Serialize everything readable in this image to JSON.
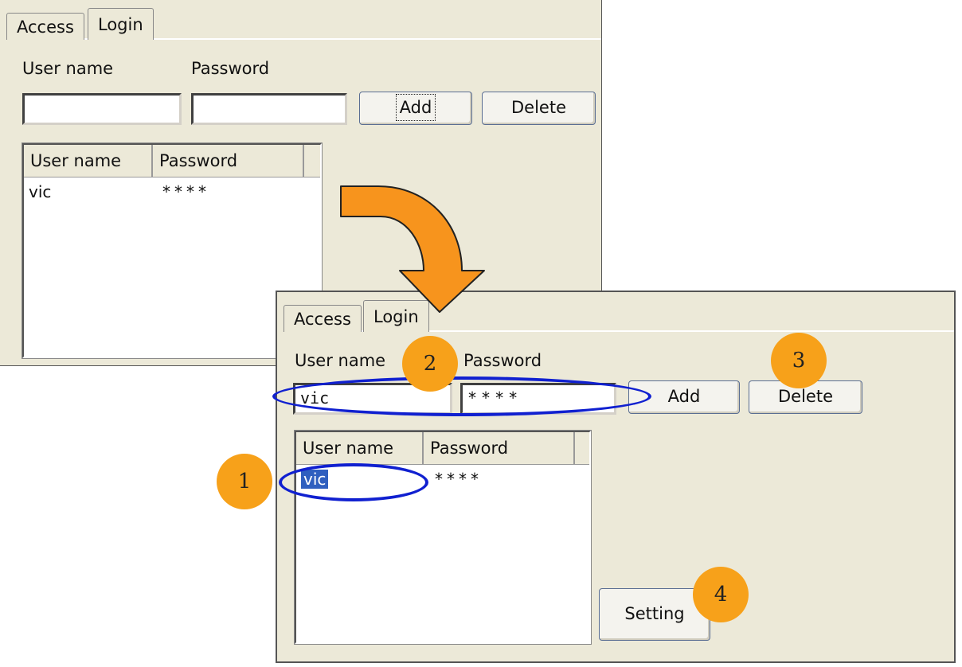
{
  "top_dialog": {
    "tabs": [
      {
        "label": "Access"
      },
      {
        "label": "Login"
      }
    ],
    "user_name_label": "User name",
    "password_label": "Password",
    "user_name_value": "",
    "password_value": "",
    "add_label": "Add",
    "delete_label": "Delete",
    "list": {
      "columns": [
        "User name",
        "Password"
      ],
      "rows": [
        {
          "user": "vic",
          "password": "****"
        }
      ]
    }
  },
  "bottom_dialog": {
    "tabs": [
      {
        "label": "Access"
      },
      {
        "label": "Login"
      }
    ],
    "user_name_label": "User name",
    "password_label": "Password",
    "user_name_value": "vic",
    "password_value": "****",
    "add_label": "Add",
    "delete_label": "Delete",
    "setting_label": "Setting",
    "list": {
      "columns": [
        "User name",
        "Password"
      ],
      "rows": [
        {
          "user": "vic",
          "password": "****",
          "selected": true
        }
      ]
    }
  },
  "callouts": [
    "1",
    "2",
    "3",
    "4"
  ],
  "colors": {
    "dialog_bg": "#ece9d8",
    "arrow": "#f7941d",
    "badge": "#f7a11a",
    "highlight": "#1020d0",
    "selection": "#2f5fbf"
  }
}
